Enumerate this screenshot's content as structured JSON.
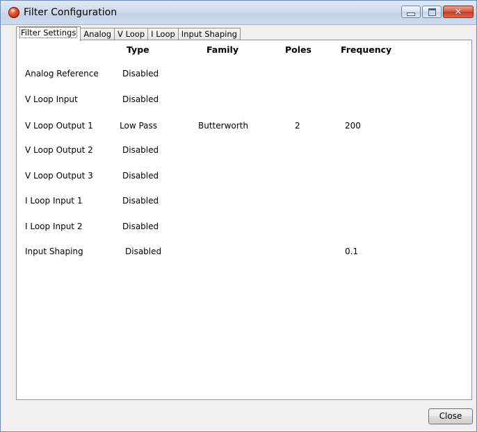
{
  "window": {
    "title": "Filter Configuration",
    "controls": {
      "minimize": "minimize",
      "maximize": "maximize",
      "close": "✕"
    }
  },
  "tabs": [
    "Filter Settings",
    "Analog",
    "V Loop",
    "I Loop",
    "Input Shaping"
  ],
  "active_tab": "Filter Settings",
  "table": {
    "headers": {
      "type": "Type",
      "family": "Family",
      "poles": "Poles",
      "frequency": "Frequency"
    },
    "rows": [
      {
        "name": "Analog Reference",
        "type": "Disabled",
        "family": "",
        "poles": "",
        "frequency": ""
      },
      {
        "name": "V Loop Input",
        "type": "Disabled",
        "family": "",
        "poles": "",
        "frequency": ""
      },
      {
        "name": "V Loop Output 1",
        "type": "Low Pass",
        "family": "Butterworth",
        "poles": "2",
        "frequency": "200"
      },
      {
        "name": "V Loop Output 2",
        "type": "Disabled",
        "family": "",
        "poles": "",
        "frequency": ""
      },
      {
        "name": "V Loop Output 3",
        "type": "Disabled",
        "family": "",
        "poles": "",
        "frequency": ""
      },
      {
        "name": "I Loop Input 1",
        "type": "Disabled",
        "family": "",
        "poles": "",
        "frequency": ""
      },
      {
        "name": "I Loop Input 2",
        "type": "Disabled",
        "family": "",
        "poles": "",
        "frequency": ""
      },
      {
        "name": "Input Shaping",
        "type": "Disabled",
        "family": "",
        "poles": "",
        "frequency": "0.1"
      }
    ]
  },
  "buttons": {
    "close": "Close"
  }
}
